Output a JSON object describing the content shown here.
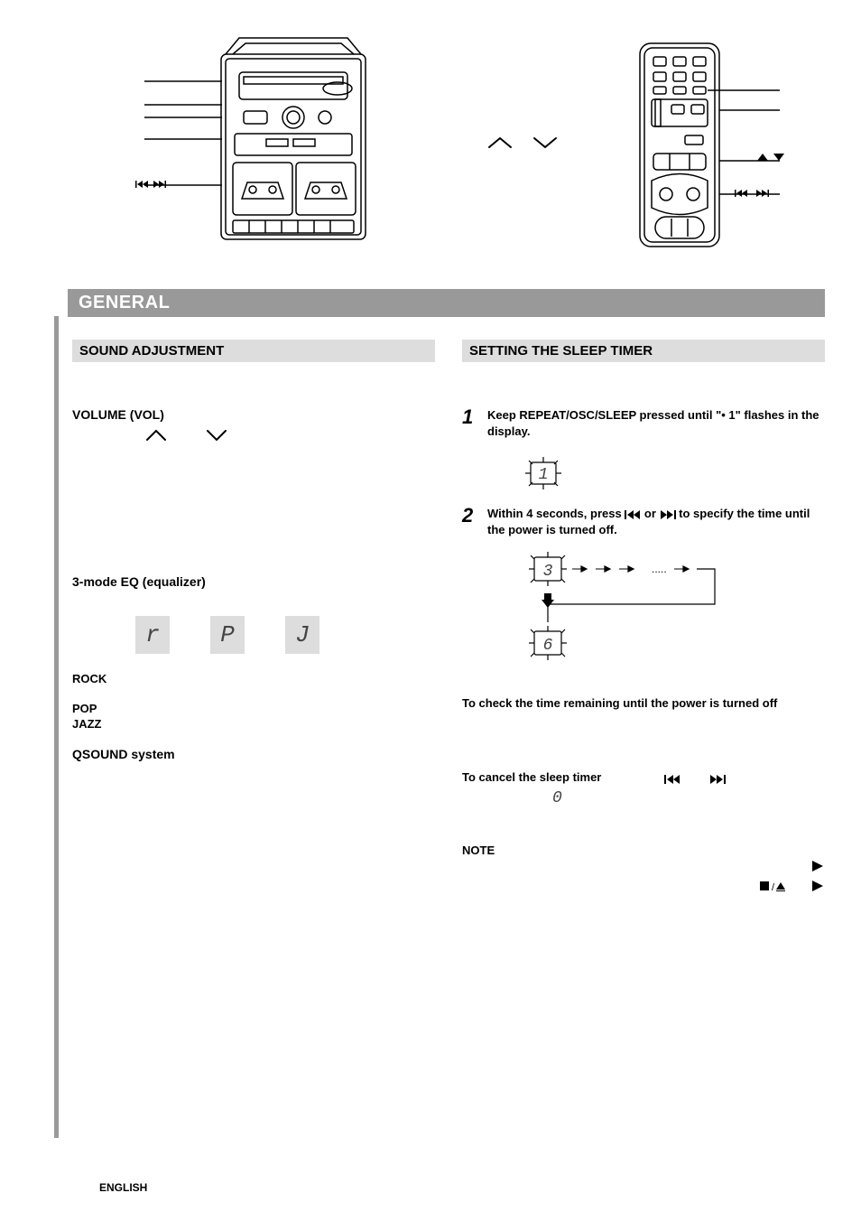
{
  "general": {
    "title": "GENERAL"
  },
  "sound": {
    "header": "SOUND ADJUSTMENT",
    "volume_label": "VOLUME (VOL)",
    "eq_label": "3-mode EQ (equalizer)",
    "eq_modes": {
      "rock": "ROCK",
      "pop": "POP",
      "jazz": "JAZZ"
    },
    "eq_glyphs": {
      "r": "r",
      "p": "P",
      "j": "J"
    },
    "qsound": "QSOUND system"
  },
  "sleep": {
    "header": "SETTING THE SLEEP TIMER",
    "step1_text": "Keep REPEAT/OSC/SLEEP pressed until \"• 1\" flashes in the display.",
    "step2_text": "Within 4 seconds, press       or       to specify the time until the power is turned off.",
    "check_text": "To check the time remaining until the power is turned off",
    "cancel_text": "To cancel the sleep timer",
    "note_label": "NOTE"
  },
  "footnote": "ENGLISH"
}
